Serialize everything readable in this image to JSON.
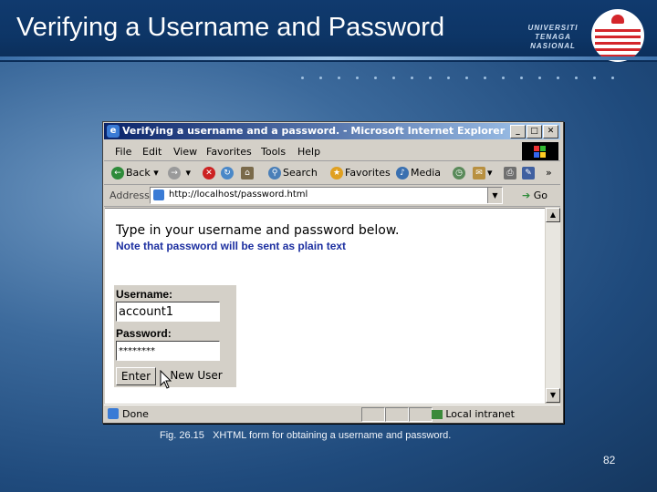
{
  "slide": {
    "title": "Verifying a Username and Password",
    "caption": "Fig. 26.15   XHTML form for obtaining a username and password.",
    "page_number": "82",
    "logo_text_1": "UNIVERSITI",
    "logo_text_2": "TENAGA",
    "logo_text_3": "NASIONAL"
  },
  "window": {
    "title": "Verifying a username and a password. - Microsoft Internet Explorer",
    "menu": [
      "File",
      "Edit",
      "View",
      "Favorites",
      "Tools",
      "Help"
    ],
    "toolbar": {
      "back": "Back",
      "search": "Search",
      "favorites": "Favorites",
      "media": "Media"
    },
    "address_label": "Address",
    "address_url": "http://localhost/password.html",
    "go_label": "Go",
    "status_left": "Done",
    "status_zone": "Local intranet"
  },
  "page": {
    "intro": "Type in your username and password below.",
    "note": "Note that password will be sent as plain text",
    "username_label": "Username:",
    "username_value": "account1",
    "password_label": "Password:",
    "password_value": "********",
    "enter_button": "Enter",
    "new_user_button": "New User"
  },
  "colors": {
    "note_blue": "#1c2fa0",
    "titlebar": "#0a246a"
  }
}
